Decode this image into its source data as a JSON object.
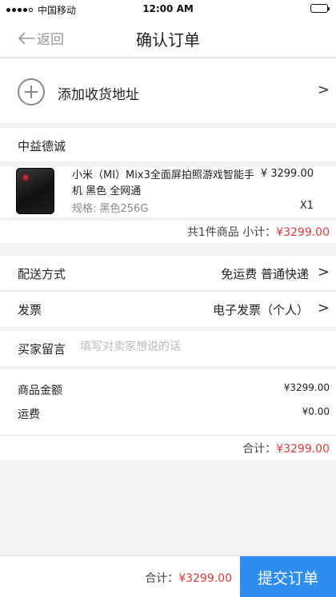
{
  "status_bar": {
    "carrier": "中国移动",
    "time": "12:00 AM"
  },
  "nav": {
    "back_label": "返回",
    "title": "确认订单"
  },
  "address": {
    "add_label": "添加收货地址"
  },
  "shop": {
    "name": "中益德诚",
    "product": {
      "name": "小米（MI）Mix3全面屏拍照游戏智能手机 黑色 全网通",
      "spec": "规格: 黑色256G",
      "price": "¥ 3299.00",
      "qty": "X1"
    },
    "count_label": "共1件商品",
    "subtotal_label": "小计：",
    "subtotal_value": "¥3299.00"
  },
  "delivery": {
    "label": "配送方式",
    "value": "免运费 普通快递"
  },
  "invoice": {
    "label": "发票",
    "value": "电子发票（个人）"
  },
  "message": {
    "label": "买家留言",
    "placeholder": "填写对卖家想说的话"
  },
  "summary": {
    "goods_label": "商品金额",
    "goods_value": "¥3299.00",
    "freight_label": "运费",
    "freight_value": "¥0.00",
    "total_label": "合计：",
    "total_value": "¥3299.00"
  },
  "footer": {
    "total_label": "合计：",
    "total_value": "¥3299.00",
    "submit_label": "提交订单"
  },
  "icons": {
    "back": "arrow-left-icon",
    "add": "plus-circle-icon",
    "chevron": "chevron-right-icon"
  },
  "colors": {
    "accent": "#2e8ef0",
    "price": "#e4393c"
  }
}
